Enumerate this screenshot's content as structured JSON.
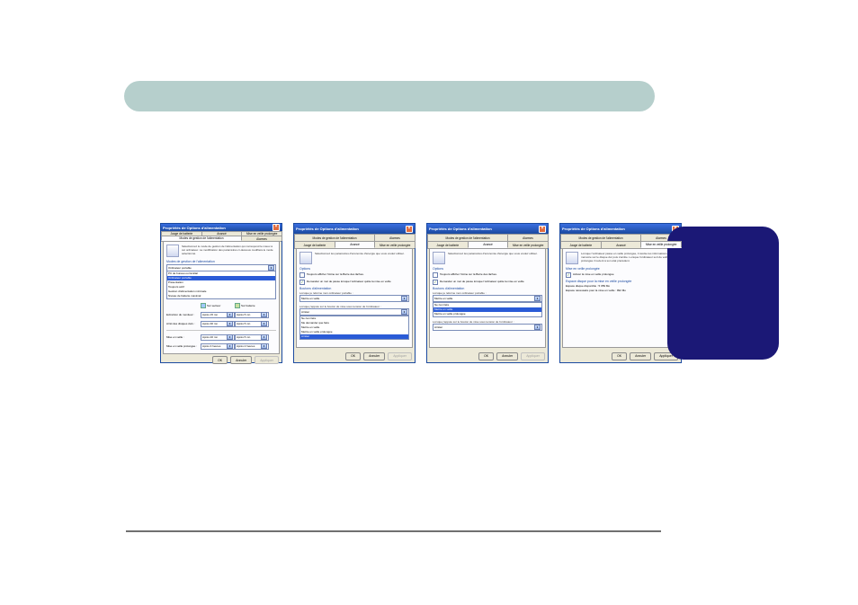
{
  "dialog_title": "Propriétés de Options d'alimentation",
  "tabs": {
    "modes": "Modes de gestion de l'alimentation",
    "alarmes": "Alarmes",
    "jauge": "Jauge de batterie",
    "avance": "Avancé",
    "veille": "Mise en veille prolongée"
  },
  "buttons": {
    "ok": "OK",
    "cancel": "Annuler",
    "apply": "Appliquer"
  },
  "d1": {
    "desc": "Sélectionnez le mode de gestion de l'alimentation qui correspond le mieux à cet ordinateur. La modification des paramètres ci-dessous modifiera le mode sélectionné.",
    "group1": "Modes de gestion de l'alimentation",
    "combo_sel": "Ordinateur portable",
    "list": [
      "PC de bureau ou familial",
      "Ordinateur portable",
      "Présentation",
      "Toujours actif",
      "Gestion d'alimentation minimale",
      "Niveau de batterie maximal"
    ],
    "list_sel": 1,
    "group2": "Paramètres du mode Ordinateur portable",
    "col_net": "Sur secteur",
    "col_bat": "Sur batterie",
    "r1": "Extinction du moniteur :",
    "r1a": "Après 15 mn",
    "r1b": "Après 5 mn",
    "r2": "Arrêt des disques durs :",
    "r2a": "Après 30 mn",
    "r2b": "Après 5 mn",
    "r3": "Mise en veille :",
    "r3a": "Après 20 mn",
    "r3b": "Après 5 mn",
    "r4": "Mise en veille prolongée :",
    "r4a": "Après 3 heures",
    "r4b": "Après 2 heures"
  },
  "d2": {
    "desc": "Sélectionnez les paramètres d'économie d'énergie que vous voulez utiliser.",
    "group1": "Options",
    "chk1": "Toujours afficher l'icône sur la Barre des tâches.",
    "chk2": "Demander un mot de passe lorsque l'ordinateur quitte la mise en veille",
    "group2": "Boutons d'alimentation",
    "lbl1": "Lorsque je referme mon ordinateur portable :",
    "c1": "Mettre en veille",
    "lbl2": "Lorsque j'appuie sur le bouton de mise sous tension de l'ordinateur :",
    "c2": "Arrêter",
    "list2": [
      "Ne rien faire",
      "Me demander que faire",
      "Mettre en veille",
      "Mettre en veille prolongée",
      "Arrêter"
    ],
    "list2_sel": 4
  },
  "d3": {
    "desc": "Sélectionnez les paramètres d'économie d'énergie que vous voulez utiliser.",
    "group1": "Options",
    "chk1": "Toujours afficher l'icône sur la Barre des tâches.",
    "chk2": "Demander un mot de passe lorsque l'ordinateur quitte la mise en veille",
    "group2": "Boutons d'alimentation",
    "lbl1": "Lorsque je referme mon ordinateur portable :",
    "c1": "Mettre en veille",
    "list1": [
      "Ne rien faire",
      "Mettre en veille",
      "Mettre en veille prolongée"
    ],
    "list1_sel": 1,
    "lbl2": "Lorsque j'appuie sur le bouton de mise sous tension de l'ordinateur :",
    "c2": "Arrêter"
  },
  "d4": {
    "desc": "Lorsque l'ordinateur passe en veille prolongée, il stocke les informations en mémoire sur le disque dur puis s'arrête. Lorsque l'ordinateur sort de veille prolongée il revient à son état précédent.",
    "group1": "Mise en veille prolongée",
    "chk1": "Activer la mise en veille prolongée",
    "group2": "Espace disque pour la mise en veille prolongée",
    "l1": "Espace disque disponible :",
    "v1": "5 059 Mo",
    "l2": "Espace nécessaire pour la mise en veille :",
    "v2": "992 Mo"
  }
}
